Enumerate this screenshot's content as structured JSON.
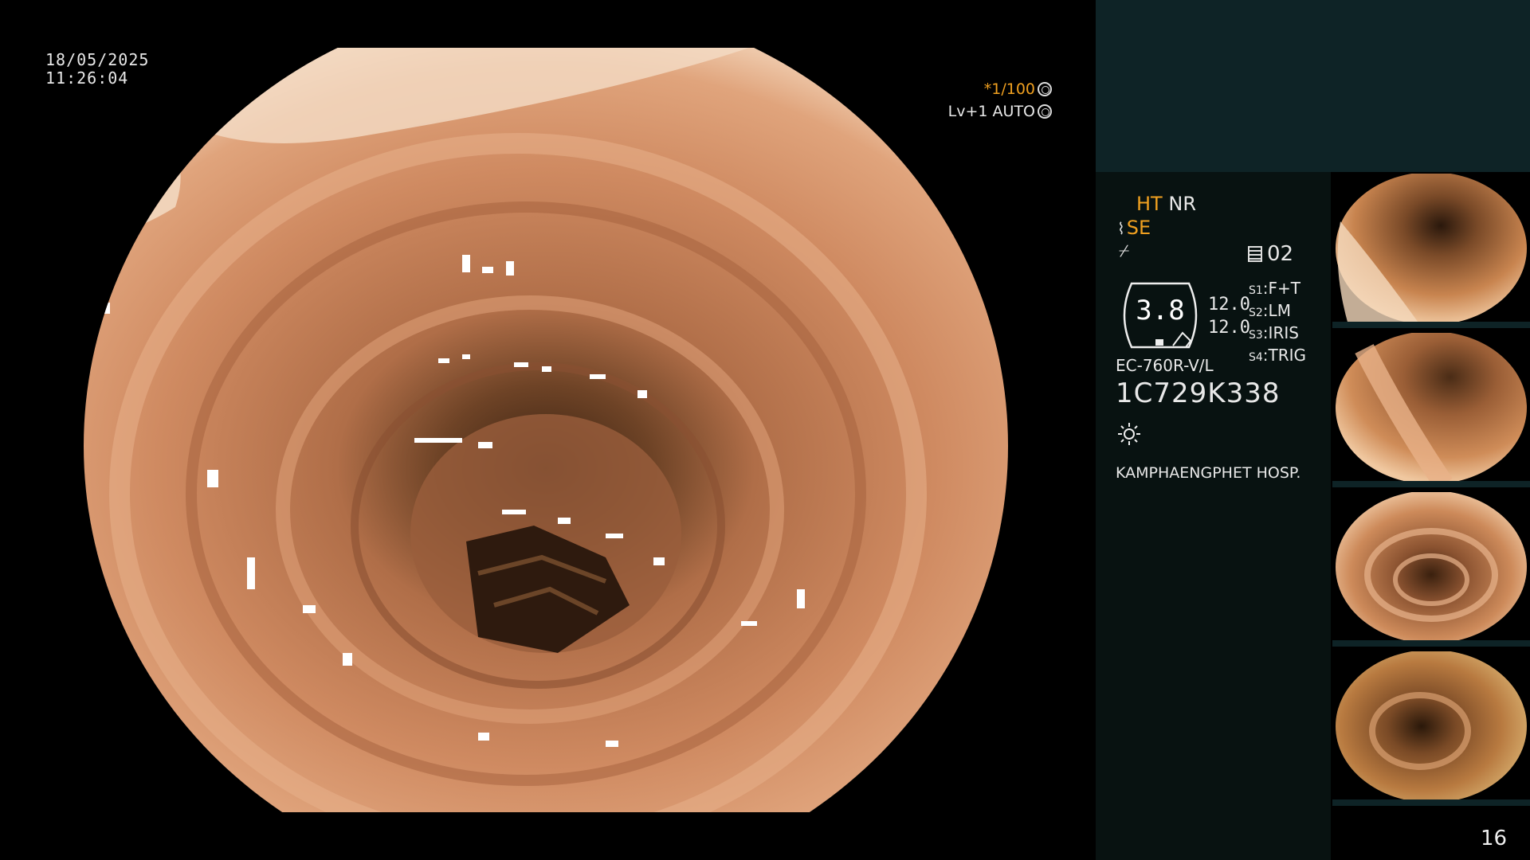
{
  "overlay": {
    "date": "18/05/2025",
    "time": "11:26:04",
    "shutter": "*1/100",
    "level": "Lv+1 AUTO"
  },
  "panel": {
    "ht": "HT",
    "nr": "NR",
    "se": "SE",
    "channel": "02",
    "gauge_value": "3.8",
    "value_1": "12.0",
    "value_2": "12.0",
    "switches": [
      {
        "key": "S1",
        "value": "F+T"
      },
      {
        "key": "S2",
        "value": "LM"
      },
      {
        "key": "S3",
        "value": "IRIS"
      },
      {
        "key": "S4",
        "value": "TRIG"
      }
    ],
    "model": "EC-760R-V/L",
    "serial": "1C729K338",
    "hospital": "KAMPHAENGPHET HOSP."
  },
  "thumbnails": {
    "serial": "1C729K338",
    "count": 4
  },
  "page_number": "16"
}
